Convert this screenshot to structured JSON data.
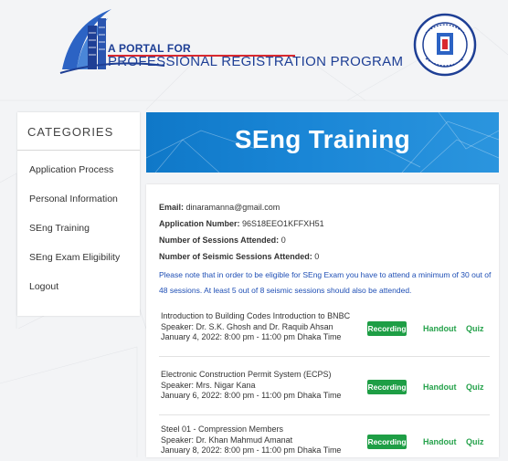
{
  "header": {
    "logo_line1": "A PORTAL FOR",
    "logo_line2": "PROFESSIONAL REGISTRATION PROGRAM",
    "seal_icon": "bangladesh-government-seal-icon"
  },
  "sidebar": {
    "title": "CATEGORIES",
    "items": [
      {
        "label": "Application Process"
      },
      {
        "label": "Personal Information"
      },
      {
        "label": "SEng Training"
      },
      {
        "label": "SEng Exam Eligibility"
      },
      {
        "label": "Logout"
      }
    ]
  },
  "banner": {
    "title": "SEng Training"
  },
  "info": {
    "email_label": "Email:",
    "email_value": "dinaramanna@gmail.com",
    "appno_label": "Application Number:",
    "appno_value": "96S18EEO1KFFXH51",
    "sessions_label": "Number of Sessions Attended:",
    "sessions_value": "0",
    "seismic_label": "Number of Seismic Sessions Attended:",
    "seismic_value": "0",
    "notice": "Please note that in order to be eligible for SEng Exam you have to attend a minimum of 30 out of 48 sessions. At least 5 out of 8 seismic sessions should also be attended."
  },
  "sessions": [
    {
      "title": "Introduction to Building Codes Introduction to BNBC",
      "speaker": "Speaker: Dr. S.K. Ghosh and Dr. Raquib Ahsan",
      "date": "January 4, 2022: 8:00 pm - 11:00 pm Dhaka Time",
      "recording": "Recording",
      "handout": "Handout",
      "quiz": "Quiz"
    },
    {
      "title": "Electronic Construction Permit System (ECPS)",
      "speaker": "Speaker: Mrs. Nigar Kana",
      "date": "January 6, 2022: 8:00 pm - 11:00 pm Dhaka Time",
      "recording": "Recording",
      "handout": "Handout",
      "quiz": "Quiz"
    },
    {
      "title": "Steel 01 - Compression Members",
      "speaker": "Speaker: Dr. Khan Mahmud Amanat",
      "date": "January 8, 2022: 8:00 pm - 11:00 pm Dhaka Time",
      "recording": "Recording",
      "handout": "Handout",
      "quiz": "Quiz"
    }
  ],
  "colors": {
    "brand_blue": "#1e3f95",
    "accent_red": "#d9292f",
    "banner_blue": "#1a86d6",
    "notice_blue": "#1f4fb5",
    "action_green": "#1e9e45"
  }
}
